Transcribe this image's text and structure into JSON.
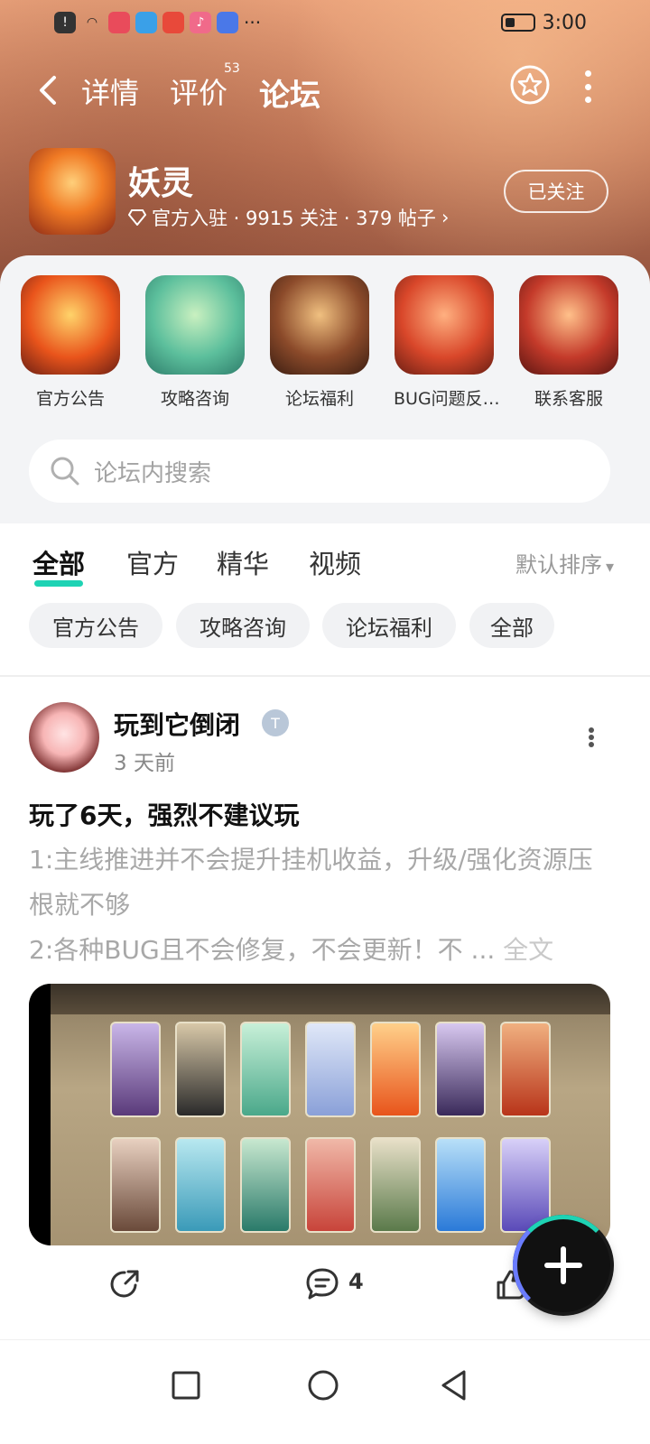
{
  "status_bar": {
    "time": "3:00"
  },
  "nav": {
    "tabs": [
      {
        "label": "详情"
      },
      {
        "label": "评价",
        "badge": "53"
      },
      {
        "label": "论坛",
        "active": true
      }
    ]
  },
  "game": {
    "name": "妖灵",
    "meta": "官方入驻 · 9915 关注 · 379 帖子",
    "follow_label": "已关注"
  },
  "quick_links": [
    {
      "label": "官方公告"
    },
    {
      "label": "攻略咨询"
    },
    {
      "label": "论坛福利"
    },
    {
      "label": "BUG问题反…"
    },
    {
      "label": "联系客服"
    }
  ],
  "search": {
    "placeholder": "论坛内搜索"
  },
  "tabs": [
    {
      "label": "全部",
      "active": true
    },
    {
      "label": "官方"
    },
    {
      "label": "精华"
    },
    {
      "label": "视频"
    }
  ],
  "sort_label": "默认排序",
  "chips": [
    {
      "label": "官方公告"
    },
    {
      "label": "攻略咨询"
    },
    {
      "label": "论坛福利"
    },
    {
      "label": "全部"
    }
  ],
  "post": {
    "author": "玩到它倒闭",
    "time": "3 天前",
    "title": "玩了6天，强烈不建议玩",
    "body_line1": "1:主线推进并不会提升挂机收益，升级/强化资源压根就不够",
    "body_line2": "2:各种BUG且不会修复，不会更新！不 ...",
    "read_all": "全文",
    "comment_count": "4"
  },
  "colors": {
    "accent": "#1ed3b4",
    "placeholder": "#a3a3a3"
  }
}
